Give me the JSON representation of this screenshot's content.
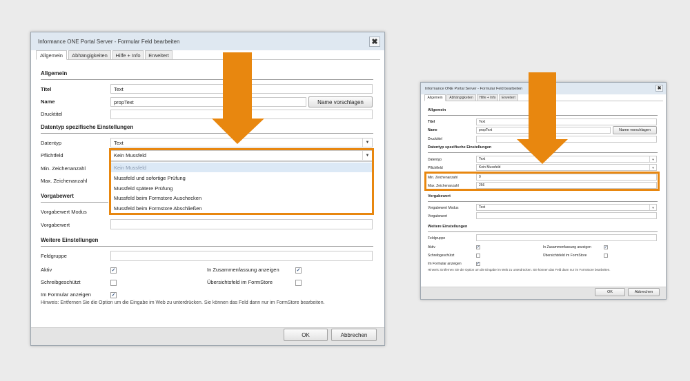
{
  "colors": {
    "accent_orange": "#e8870f",
    "titlebar": "#dfe8f1",
    "checkbox_tick": "#3b5a86"
  },
  "dialog": {
    "title": "Informance ONE Portal Server - Formular Feld bearbeiten",
    "close_icon": "close-icon",
    "tabs": [
      "Allgemein",
      "Abhängigkeiten",
      "Hilfe + Info",
      "Erweitert"
    ],
    "sections": {
      "general": "Allgemein",
      "datatype": "Datentyp spezifische Einstellungen",
      "default": "Vorgabewert",
      "more": "Weitere Einstellungen"
    },
    "labels": {
      "title": "Titel",
      "name": "Name",
      "printtitle": "Drucktitel",
      "datatype": "Datentyp",
      "required": "Pflichtfeld",
      "min": "Min. Zeichenanzahl",
      "max": "Max. Zeichenanzahl",
      "default_mode": "Vorgabewert Modus",
      "default_value": "Vorgabewert",
      "fieldgroup": "Feldgruppe",
      "active": "Aktiv",
      "summary": "In Zusammenfassung anzeigen",
      "readonly": "Schreibgeschützt",
      "overview": "Übersichtsfeld im FormStore",
      "in_form": "Im Formular anzeigen"
    },
    "values": {
      "title": "Text",
      "name": "propText",
      "datatype": "Text",
      "required": "Kein Mussfeld",
      "default_mode": "Text"
    },
    "suggest_button": "Name vorschlagen",
    "hint": "Hinweis: Entfernen Sie die Option um die Eingabe im Web zu unterdrücken. Sie können das Feld dann nur im FormStore bearbeiten.",
    "checkboxes": {
      "active": true,
      "summary": true,
      "readonly": false,
      "overview": false,
      "in_form": true
    },
    "ok_button": "OK",
    "cancel_button": "Abbrechen"
  },
  "left": {
    "required_options": [
      "Kein Mussfeld",
      "Mussfeld und sofortige Prüfung",
      "Mussfeld spätere Prüfung",
      "Mussfeld beim Formstore Auschecken",
      "Mussfeld beim Formstore Abschließen"
    ]
  },
  "right": {
    "values": {
      "min": "0",
      "max": "256"
    }
  }
}
